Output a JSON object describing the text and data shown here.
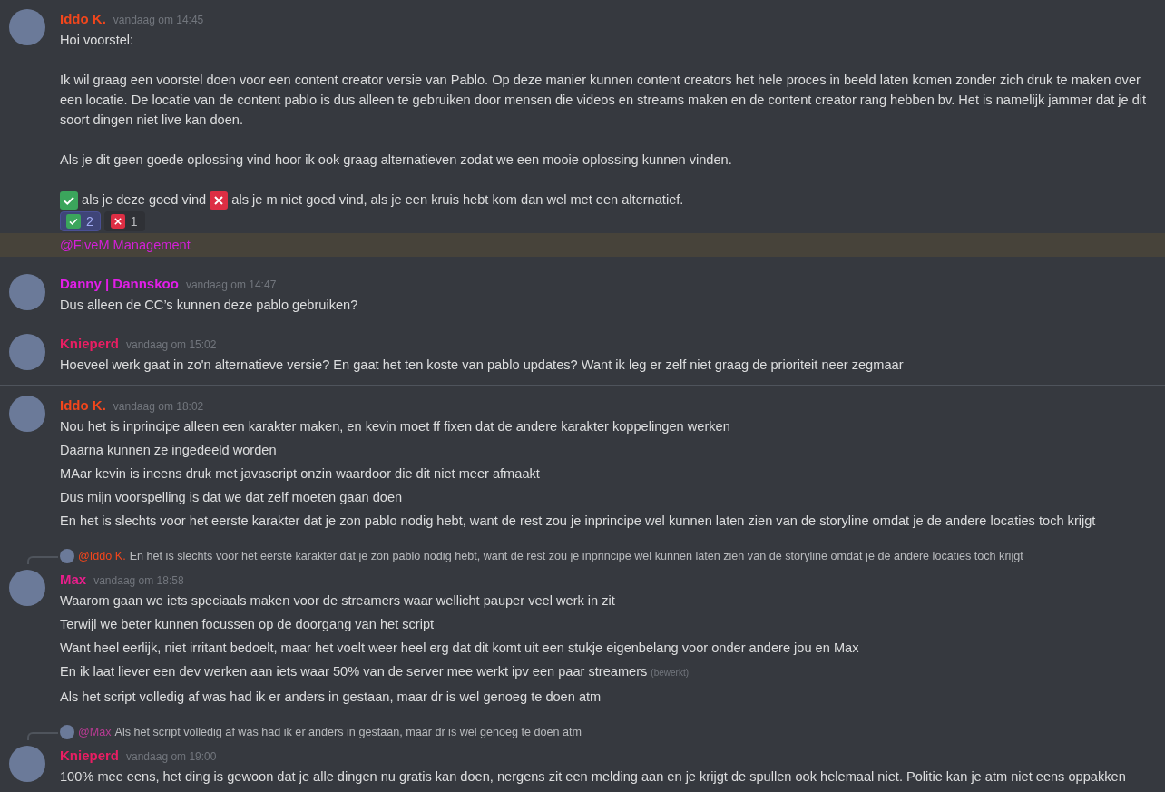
{
  "messages": [
    {
      "author": "Iddo K.",
      "color": "#f2461c",
      "timestamp": "vandaag om 14:45",
      "divider_before": false,
      "lines": [
        {
          "highlighted": false,
          "segments": [
            {
              "kind": "text",
              "text": "Hoi voorstel:\n\nIk wil graag een voorstel doen voor een content creator versie van Pablo. Op deze manier kunnen content creators het hele proces in beeld laten komen zonder zich druk te maken over een locatie. De locatie van de content pablo is dus alleen te gebruiken door mensen die videos en streams maken en de content creator rang hebben bv. Het is namelijk jammer dat je dit soort dingen niet live kan doen.\n\nAls je dit geen goede oplossing vind hoor ik ook graag alternatieven zodat we een mooie oplossing kunnen vinden.\n\n"
            },
            {
              "kind": "check"
            },
            {
              "kind": "text",
              "text": " als je deze goed vind "
            },
            {
              "kind": "cross"
            },
            {
              "kind": "text",
              "text": " als je m niet goed vind, als je een kruis hebt kom dan wel met een alternatief."
            }
          ],
          "reactions": [
            {
              "kind": "check",
              "count": "2",
              "selected": true
            },
            {
              "kind": "cross",
              "count": "1",
              "selected": false
            }
          ]
        },
        {
          "highlighted": true,
          "segments": [
            {
              "kind": "mention",
              "text": "@FiveM Management",
              "color": "#d41fd9"
            }
          ]
        }
      ]
    },
    {
      "author": "Danny | Dannskoo",
      "color": "#e21ee8",
      "timestamp": "vandaag om 14:47",
      "divider_before": false,
      "lines": [
        {
          "highlighted": false,
          "segments": [
            {
              "kind": "text",
              "text": "Dus alleen de CC’s kunnen deze pablo gebruiken?"
            }
          ]
        }
      ]
    },
    {
      "author": "Knieperd",
      "color": "#e91e63",
      "timestamp": "vandaag om 15:02",
      "divider_before": false,
      "lines": [
        {
          "highlighted": false,
          "segments": [
            {
              "kind": "text",
              "text": "Hoeveel werk gaat in zo'n alternatieve versie? En gaat het ten koste van pablo updates? Want ik leg er zelf niet graag de prioriteit neer zegmaar"
            }
          ]
        }
      ]
    },
    {
      "author": "Iddo K.",
      "color": "#f2461c",
      "timestamp": "vandaag om 18:02",
      "divider_before": true,
      "lines": [
        {
          "highlighted": false,
          "segments": [
            {
              "kind": "text",
              "text": "Nou het is inprincipe alleen een karakter maken, en kevin moet ff fixen dat de andere karakter koppelingen werken"
            }
          ]
        },
        {
          "highlighted": false,
          "segments": [
            {
              "kind": "text",
              "text": "Daarna kunnen ze ingedeeld worden"
            }
          ]
        },
        {
          "highlighted": false,
          "segments": [
            {
              "kind": "text",
              "text": "MAar kevin is ineens druk met javascript onzin waardoor die dit niet meer afmaakt"
            }
          ]
        },
        {
          "highlighted": false,
          "segments": [
            {
              "kind": "text",
              "text": "Dus mijn voorspelling is dat we dat zelf moeten gaan doen"
            }
          ]
        },
        {
          "highlighted": false,
          "segments": [
            {
              "kind": "text",
              "text": "En het is slechts voor het eerste karakter dat je zon pablo nodig hebt, want de rest zou je inprincipe wel kunnen laten zien van de storyline omdat je de andere locaties toch krijgt"
            }
          ]
        }
      ]
    },
    {
      "author": "Max",
      "color": "#e91e8c",
      "timestamp": "vandaag om 18:58",
      "divider_before": false,
      "reply": {
        "author": "@Iddo K.",
        "color": "#f2461c",
        "text": "En het is slechts voor het eerste karakter dat je zon pablo nodig hebt, want de rest zou je inprincipe wel kunnen laten zien van de storyline omdat je de andere locaties toch krijgt"
      },
      "lines": [
        {
          "highlighted": false,
          "segments": [
            {
              "kind": "text",
              "text": "Waarom gaan we iets speciaals maken voor de streamers waar wellicht pauper veel werk in zit"
            }
          ]
        },
        {
          "highlighted": false,
          "segments": [
            {
              "kind": "text",
              "text": "Terwijl we beter kunnen focussen op de doorgang van het script"
            }
          ]
        },
        {
          "highlighted": false,
          "segments": [
            {
              "kind": "text",
              "text": "Want heel eerlijk, niet irritant bedoelt, maar het voelt weer heel erg dat dit komt uit een stukje eigenbelang voor onder andere jou en Max"
            }
          ]
        },
        {
          "highlighted": false,
          "segments": [
            {
              "kind": "text",
              "text": "En ik laat liever een dev werken aan iets waar 50% van de server mee werkt ipv een paar streamers"
            }
          ],
          "edited": "(bewerkt)"
        },
        {
          "highlighted": false,
          "segments": [
            {
              "kind": "text",
              "text": "Als het script volledig af was had ik er anders in gestaan, maar dr is wel genoeg te doen atm"
            }
          ]
        }
      ]
    },
    {
      "author": "Knieperd",
      "color": "#e91e63",
      "timestamp": "vandaag om 19:00",
      "divider_before": false,
      "reply": {
        "author": "@Max",
        "color": "#b83b93",
        "text": "Als het script volledig af was had ik er anders in gestaan, maar dr is wel genoeg te doen atm"
      },
      "lines": [
        {
          "highlighted": false,
          "segments": [
            {
              "kind": "text",
              "text": "100% mee eens, het ding is gewoon dat je alle dingen nu gratis kan doen, nergens zit een melding aan en je krijgt de spullen ook helemaal niet. Politie kan je atm niet eens oppakken"
            }
          ]
        }
      ]
    }
  ]
}
